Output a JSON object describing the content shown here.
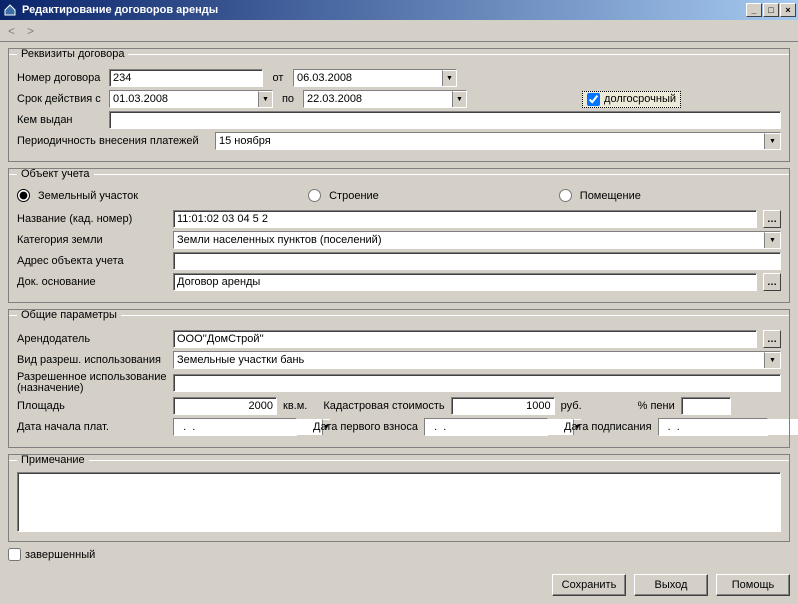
{
  "window": {
    "title": "Редактирование договоров аренды"
  },
  "nav": {
    "prev": "<",
    "next": ">"
  },
  "requisites": {
    "legend": "Реквизиты договора",
    "number_label": "Номер договора",
    "number_value": "234",
    "from_label": "от",
    "from_date": "06.03.2008",
    "period_from_label": "Срок действия с",
    "period_from": "01.03.2008",
    "to_label": "по",
    "period_to": "22.03.2008",
    "longterm_label": "долгосрочный",
    "issued_by_label": "Кем выдан",
    "issued_by": "",
    "payment_period_label": "Периодичность внесения платежей",
    "payment_period": "15 ноября"
  },
  "object": {
    "legend": "Объект учета",
    "option_land": "Земельный участок",
    "option_building": "Строение",
    "option_room": "Помещение",
    "name_label": "Название (кад. номер)",
    "name_value": "11:01:02 03 04 5 2",
    "category_label": "Категория земли",
    "category_value": "Земли населенных пунктов (поселений)",
    "address_label": "Адрес объекта учета",
    "address_value": "",
    "basis_label": "Док. основание",
    "basis_value": "Договор аренды"
  },
  "general": {
    "legend": "Общие параметры",
    "lessor_label": "Арендодатель",
    "lessor_value": "ООО''ДомСтрой''",
    "permitted_use_label": "Вид разреш. использования",
    "permitted_use_value": "Земельные участки бань",
    "purpose_label": "Разрешенное использование (назначение)",
    "purpose_value": "",
    "area_label": "Площадь",
    "area_value": "2000",
    "area_unit": "кв.м.",
    "cadastral_label": "Кадастровая стоимость",
    "cadastral_value": "1000",
    "cadastral_unit": "руб.",
    "penalty_label": "% пени",
    "penalty_value": "",
    "pay_start_label": "Дата начала плат.",
    "pay_start": "  .  .",
    "first_pay_label": "Дата первого взноса",
    "first_pay": "  .  .",
    "sign_date_label": "Дата подписания",
    "sign_date": "  .  ."
  },
  "note": {
    "legend": "Примечание",
    "value": ""
  },
  "completed_label": "завершенный",
  "buttons": {
    "save": "Сохранить",
    "exit": "Выход",
    "help": "Помощь"
  }
}
